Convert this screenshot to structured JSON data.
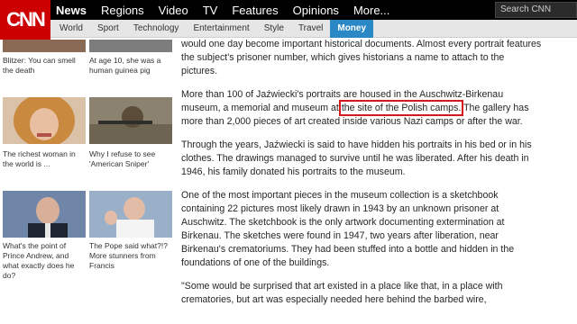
{
  "site": {
    "logo_text": "CNN",
    "brand_color": "#cc0000",
    "accent_color": "#2a88c6"
  },
  "nav": {
    "primary": [
      "News",
      "Regions",
      "Video",
      "TV",
      "Features",
      "Opinions",
      "More..."
    ],
    "active": "News",
    "search_placeholder": "Search CNN",
    "secondary": [
      "World",
      "Sport",
      "Technology",
      "Entertainment",
      "Style",
      "Travel",
      "Money"
    ],
    "secondary_selected": "Money"
  },
  "promos": [
    {
      "caption": "Blitzer: You can smell the death",
      "icon": "photo-thumbnail"
    },
    {
      "caption": "At age 10, she was a human guinea pig",
      "icon": "photo-thumbnail"
    },
    {
      "caption": "The richest woman in the world is ...",
      "icon": "photo-thumbnail"
    },
    {
      "caption": "Why I refuse to see 'American Sniper'",
      "icon": "photo-thumbnail"
    },
    {
      "caption": "What's the point of Prince Andrew, and what exactly does he do?",
      "icon": "photo-thumbnail"
    },
    {
      "caption": "The Pope said what?!? More stunners from Francis",
      "icon": "photo-thumbnail"
    }
  ],
  "article": {
    "p1": "would one day become important historical documents. Almost every portrait features the subject's prisoner number, which gives historians a name to attach to the pictures.",
    "p2_before": "More than 100 of Jaźwiecki's portraits are housed in the Auschwitz-Birkenau museum, a memorial and museum at ",
    "p2_highlight": "the site of the Polish camps.",
    "p2_after": " The gallery has more than 2,000 pieces of art created inside various Nazi camps or after the war.",
    "p3": "Through the years, Jaźwiecki is said to have hidden his portraits in his bed or in his clothes. The drawings managed to survive until he was liberated. After his death in 1946, his family donated his portraits to the museum.",
    "p4": "One of the most important pieces in the museum collection is a sketchbook containing 22 pictures most likely drawn in 1943 by an unknown prisoner at Auschwitz. The sketchbook is the only artwork documenting extermination at Birkenau. The sketches were found in 1947, two years after liberation, near Birkenau's crematoriums. They had been stuffed into a bottle and hidden in the foundations of one of the buildings.",
    "p5": "\"Some would be surprised that art existed in a place like that, in a place with crematories, but art was especially needed here behind the barbed wire,"
  },
  "highlight_color": "#d81818"
}
